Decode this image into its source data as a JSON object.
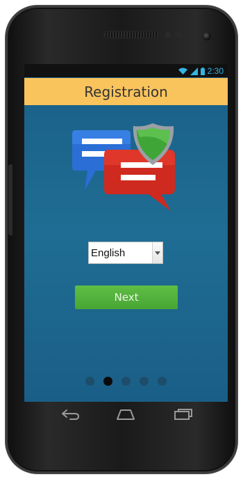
{
  "status_bar": {
    "time": "2:30"
  },
  "header": {
    "title": "Registration"
  },
  "language_select": {
    "selected": "English"
  },
  "next_button": {
    "label": "Next"
  },
  "pager": {
    "total": 5,
    "active_index": 1
  },
  "nav_bar": {
    "icons": [
      "back-icon",
      "home-icon",
      "recent-apps-icon"
    ]
  },
  "colors": {
    "title_bar": "#fac45c",
    "background": "#1f6d94",
    "button": "#53b13d",
    "status_accent": "#33b5e5"
  }
}
